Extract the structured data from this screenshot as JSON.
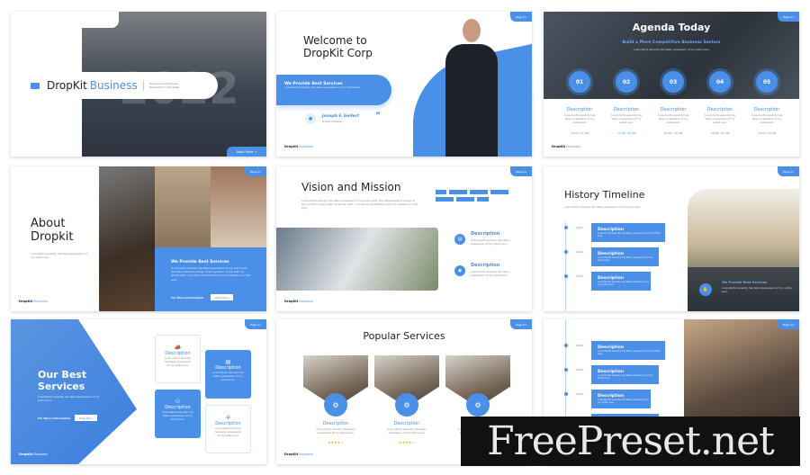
{
  "brand": {
    "name": "DropKit",
    "suffix": "Business",
    "accent": "#4a8fe8"
  },
  "lorem_short": "A wonderful serenity has taken possession of my entire soul.",
  "lorem_long": "A wonderful serenity has taken possession of my entire soul, like these sweet mornings of spring which I enjoy with my whole heart. I am alone and feel the charm of existence in this spot.",
  "desc": "Description",
  "read_more": "Read More",
  "for_more": "For More Information",
  "best_services": "We Provide Best Services",
  "page_label": "Page 01",
  "slide1": {
    "title_a": "DropKit",
    "title_b": "Business",
    "subtitle": "Professional Business Presentation Template",
    "year": "2022",
    "button": "Read More →"
  },
  "slide2": {
    "title": "Welcome to DropKit Corp",
    "person": "Joseph F. Gellert",
    "role": "Project Manager",
    "quote": "”"
  },
  "slide3": {
    "title": "Agenda Today",
    "subtitle": "Build a More Competitive Business Sectors",
    "items": [
      {
        "n": "01",
        "time": "12 PM - 01 AM"
      },
      {
        "n": "02",
        "time": "11 PM - 09 AM"
      },
      {
        "n": "03",
        "time": "03 PM - 12 AM"
      },
      {
        "n": "04",
        "time": "12 PM - 01 AM"
      },
      {
        "n": "05",
        "time": "12 PM - 09 AM"
      }
    ]
  },
  "slide4": {
    "title": "About Dropkit"
  },
  "slide5": {
    "title": "Vision and Mission"
  },
  "slide6": {
    "title": "History Timeline",
    "years": [
      "2012",
      "2014",
      "2016"
    ]
  },
  "slide7": {
    "title": "Our Best Services"
  },
  "slide8": {
    "title": "Popular Services",
    "rating": 4,
    "max_rating": 5
  },
  "slide9": {
    "years": [
      "2018",
      "2020",
      "2022",
      "2024"
    ]
  },
  "watermark": "FreePreset.net"
}
